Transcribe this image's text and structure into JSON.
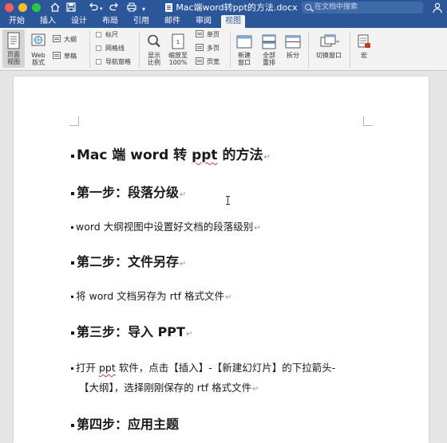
{
  "titlebar": {
    "doc_title": "Mac端word转ppt的方法.docx",
    "search_placeholder": "在文档中搜索",
    "quick_access": [
      "home-icon",
      "save-icon",
      "undo-icon",
      "redo-icon",
      "print-icon",
      "customize-icon"
    ]
  },
  "tabs": [
    "开始",
    "插入",
    "设计",
    "布局",
    "引用",
    "邮件",
    "审阅",
    "视图"
  ],
  "active_tab": "视图",
  "ribbon": {
    "page_view": "页面\n视图",
    "web_view": "Web\n版式",
    "outline": "大纲",
    "draft": "草稿",
    "ruler": "标尺",
    "gridlines": "网格线",
    "nav_pane": "导航窗格",
    "zoom": "显示\n比例",
    "zoom_100": "缩放至\n100%",
    "one_page": "单页",
    "multi_page": "多页",
    "page_width": "页宽",
    "new_window": "新建\n窗口",
    "arrange_all": "全部\n重排",
    "split": "拆分",
    "switch_window": "切换窗口",
    "macros": "宏"
  },
  "document": {
    "title": "Mac 端 word 转 ppt 的方法",
    "steps": [
      {
        "heading": "第一步：段落分级",
        "body": [
          "word  大纲视图中设置好文档的段落级别"
        ]
      },
      {
        "heading": "第二步：文件另存",
        "body": [
          "将 word 文档另存为 rtf 格式文件"
        ]
      },
      {
        "heading": "第三步：导入 PPT",
        "body": [
          "打开 ppt 软件，点击【插入】-【新建幻灯片】的下拉箭头-",
          "【大纲】，选择刚刚保存的 rtf 格式文件"
        ]
      },
      {
        "heading": "第四步：应用主题",
        "body": []
      }
    ],
    "paragraph_mark": "↵"
  },
  "colors": {
    "word_blue": "#2b579a",
    "ribbon_bg": "#f3f3f3",
    "canvas_bg": "#e6e6e6"
  }
}
